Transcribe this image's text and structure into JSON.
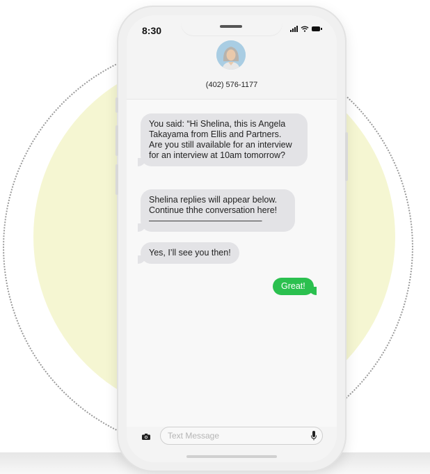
{
  "status_bar": {
    "time": "8:30"
  },
  "contact": {
    "phone_number": "(402) 576-1177"
  },
  "messages": [
    {
      "direction": "incoming",
      "text": "You said: “Hi Shelina, this is Angela\nTakayama from Ellis and Partners.\nAre you still available for an interview\nfor an interview at 10am tomorrow?"
    },
    {
      "direction": "incoming",
      "text": "Shelina replies will appear below.\nContinue thhe conversation here!\n—————————————"
    },
    {
      "direction": "incoming",
      "text": "Yes, I’ll see you then!"
    },
    {
      "direction": "outgoing",
      "text": "Great!"
    }
  ],
  "composer": {
    "placeholder": "Text Message",
    "value": ""
  },
  "icons": {
    "camera": "camera-icon",
    "mic": "microphone-icon",
    "signal": "signal-icon",
    "wifi": "wifi-icon",
    "battery": "battery-icon"
  },
  "colors": {
    "background_circle": "#f5f6d2",
    "incoming_bubble": "#e3e3e6",
    "outgoing_bubble": "#2bc04f"
  }
}
